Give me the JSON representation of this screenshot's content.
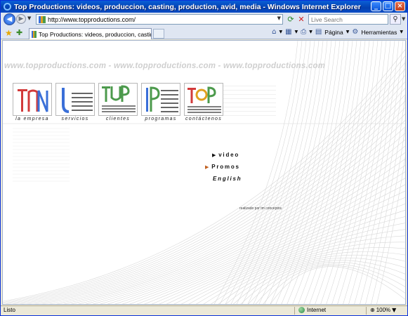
{
  "window": {
    "title": "Top Productions: videos, produccion, casting, production, avid, media - Windows Internet Explorer",
    "buttons": {
      "minimize": "_",
      "maximize": "□",
      "close": "×"
    }
  },
  "navbar": {
    "address": "http://www.topproductions.com/",
    "search_placeholder": "Live Search"
  },
  "tabs": [
    {
      "label": "Top Productions: videos, produccion, casting, product..."
    }
  ],
  "commandbar": {
    "page_label": "Página",
    "tools_label": "Herramientas"
  },
  "page": {
    "banner": "www.topproductions.com - www.topproductions.com - www.topproductions.com",
    "sections": [
      {
        "caption": "la empresa",
        "logo": "TPN"
      },
      {
        "caption": "servicios",
        "logo": "J"
      },
      {
        "caption": "clientes",
        "logo": "TUP"
      },
      {
        "caption": "programas",
        "logo": "IP"
      },
      {
        "caption": "contáctenos",
        "logo": "TOP"
      }
    ],
    "menu": [
      {
        "label": "video",
        "arrow": "▶"
      },
      {
        "label": "Promos",
        "arrow": "▶"
      },
      {
        "label": "English",
        "arrow": ""
      }
    ],
    "credit": "realizado por tm conceptos"
  },
  "statusbar": {
    "status": "Listo",
    "zone": "Internet",
    "zoom": "100%"
  },
  "colors": {
    "titlebar": "#0a4dc6",
    "logo_blue": "#3a6fd8",
    "logo_orange": "#e0a020",
    "logo_green": "#4c9a4c",
    "logo_red": "#d23a3a"
  }
}
